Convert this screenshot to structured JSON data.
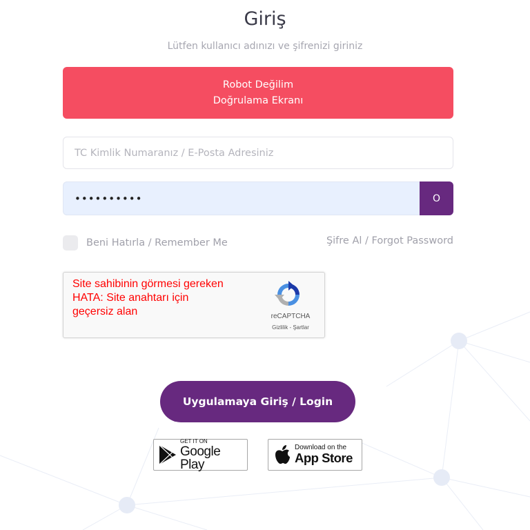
{
  "header": {
    "title": "Giriş",
    "subtitle": "Lütfen kullanıcı adınızı ve şifrenizi giriniz"
  },
  "robot_button": {
    "line1": "Robot Değilim",
    "line2": "Doğrulama Ekranı"
  },
  "tc_field": {
    "placeholder": "TC Kimlik Numaranız / E-Posta Adresiniz",
    "value": ""
  },
  "password_field": {
    "value": "••••••••••",
    "toggle_label": "O"
  },
  "remember": {
    "label": "Beni Hatırla / Remember Me",
    "checked": false
  },
  "forgot": {
    "label": "Şifre Al / Forgot Password"
  },
  "captcha": {
    "error_text": "Site sahibinin görmesi gereken HATA: Site anahtarı için geçersiz alan",
    "brand": "reCAPTCHA",
    "links": "Gizlilik - Şartlar"
  },
  "login_button": {
    "label": "Uygulamaya Giriş / Login"
  },
  "google_play": {
    "small": "GET IT ON",
    "big": "Google Play"
  },
  "app_store": {
    "small": "Download on the",
    "big": "App Store"
  },
  "colors": {
    "accent_red": "#f54d61",
    "accent_purple": "#67297f",
    "error_red": "#ff0000"
  }
}
